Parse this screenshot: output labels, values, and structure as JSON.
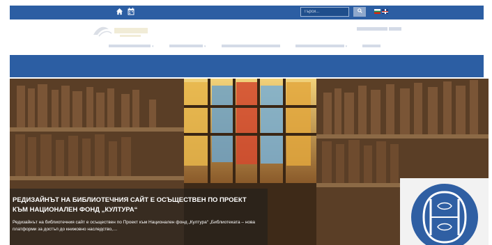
{
  "search": {
    "placeholder": "Търси..."
  },
  "hero": {
    "title": "РЕДИЗАЙНЪТ НА БИБЛИОТЕЧНИЯ САЙТ Е ОСЪЩЕСТВЕН ПО ПРОЕКТ КЪМ НАЦИОНАЛЕН ФОНД „КУЛТУРА“",
    "text": "Редизайнът на библиотечния сайт е осъществен по Проект към Национален фонд „Култура“ „Библиотеката – нова платформи за достъп до книжовно наследство,…"
  },
  "colors": {
    "brand_blue": "#2c5ea3"
  },
  "icons": {
    "home": "home-icon",
    "calendar": "calendar-icon",
    "search": "search-icon",
    "flag_bg": "bulgarian-flag-icon",
    "flag_en": "english-flag-icon"
  }
}
